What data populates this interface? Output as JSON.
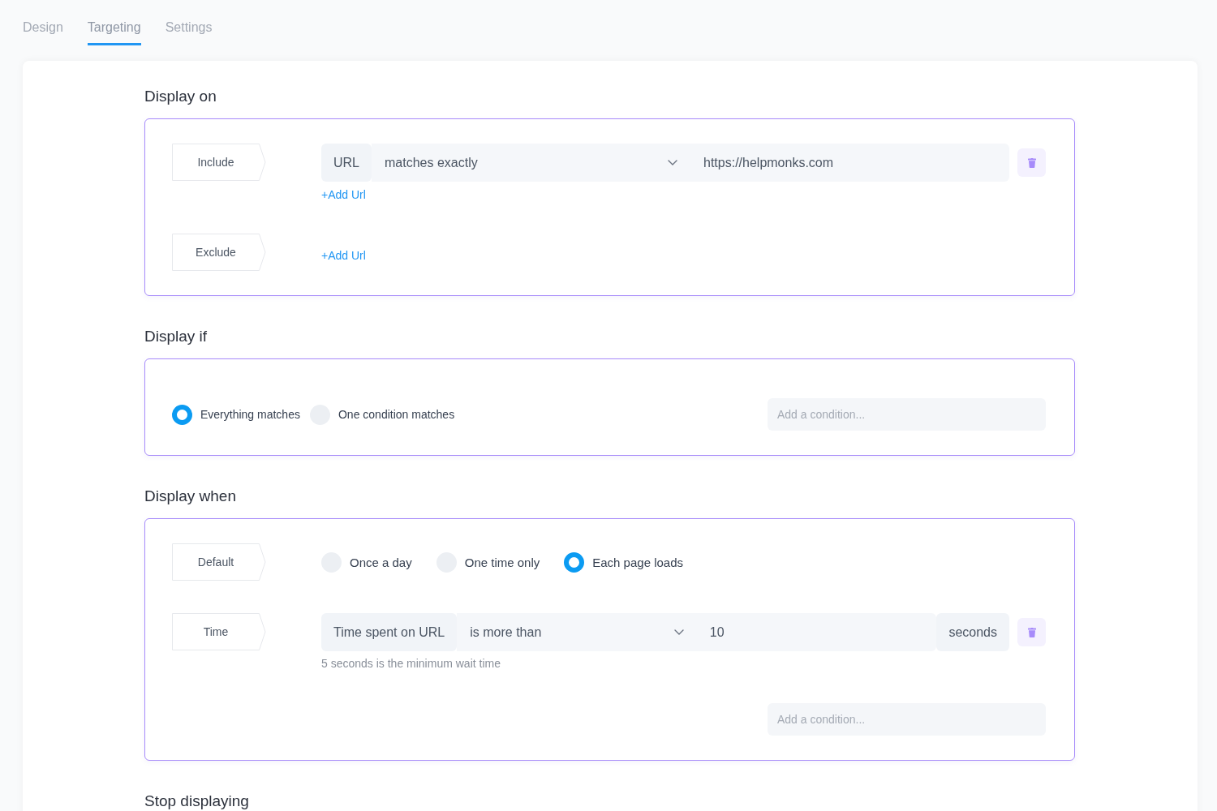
{
  "tabs": [
    {
      "label": "Design",
      "selected": false
    },
    {
      "label": "Targeting",
      "selected": true
    },
    {
      "label": "Settings",
      "selected": false
    }
  ],
  "sections": [
    {
      "kind": "rules",
      "title": "Display on",
      "rules": [
        {
          "label": "Include",
          "conditions": [
            {
              "fields": [
                {
                  "kind": "static",
                  "text": "URL"
                },
                {
                  "kind": "select",
                  "value": "matches exactly"
                },
                {
                  "kind": "input",
                  "value": "https://helpmonks.com"
                }
              ]
            }
          ],
          "add_link": "+Add Url"
        },
        {
          "label": "Exclude",
          "add_link": "+Add Url"
        }
      ]
    },
    {
      "kind": "match",
      "title": "Display if",
      "options": [
        {
          "label": "Everything matches",
          "selected": true
        },
        {
          "label": "One condition matches",
          "selected": false
        }
      ],
      "add_condition": {
        "placeholder": "Add a condition..."
      }
    },
    {
      "kind": "rules",
      "title": "Display when",
      "rules": [
        {
          "label": "Default",
          "options": [
            {
              "label": "Once a day",
              "selected": false
            },
            {
              "label": "One time only",
              "selected": false
            },
            {
              "label": "Each page loads",
              "selected": true
            }
          ]
        },
        {
          "label": "Time",
          "conditions": [
            {
              "fields": [
                {
                  "kind": "static",
                  "text": "Time spent on URL"
                },
                {
                  "kind": "select",
                  "value": "is more than"
                },
                {
                  "kind": "input",
                  "value": "10"
                },
                {
                  "kind": "static",
                  "text": "seconds"
                }
              ],
              "hint": "5 seconds is the minimum wait time"
            }
          ]
        }
      ],
      "add_condition": {
        "placeholder": "Add a condition..."
      }
    },
    {
      "kind": "heading",
      "title": "Stop displaying"
    }
  ]
}
